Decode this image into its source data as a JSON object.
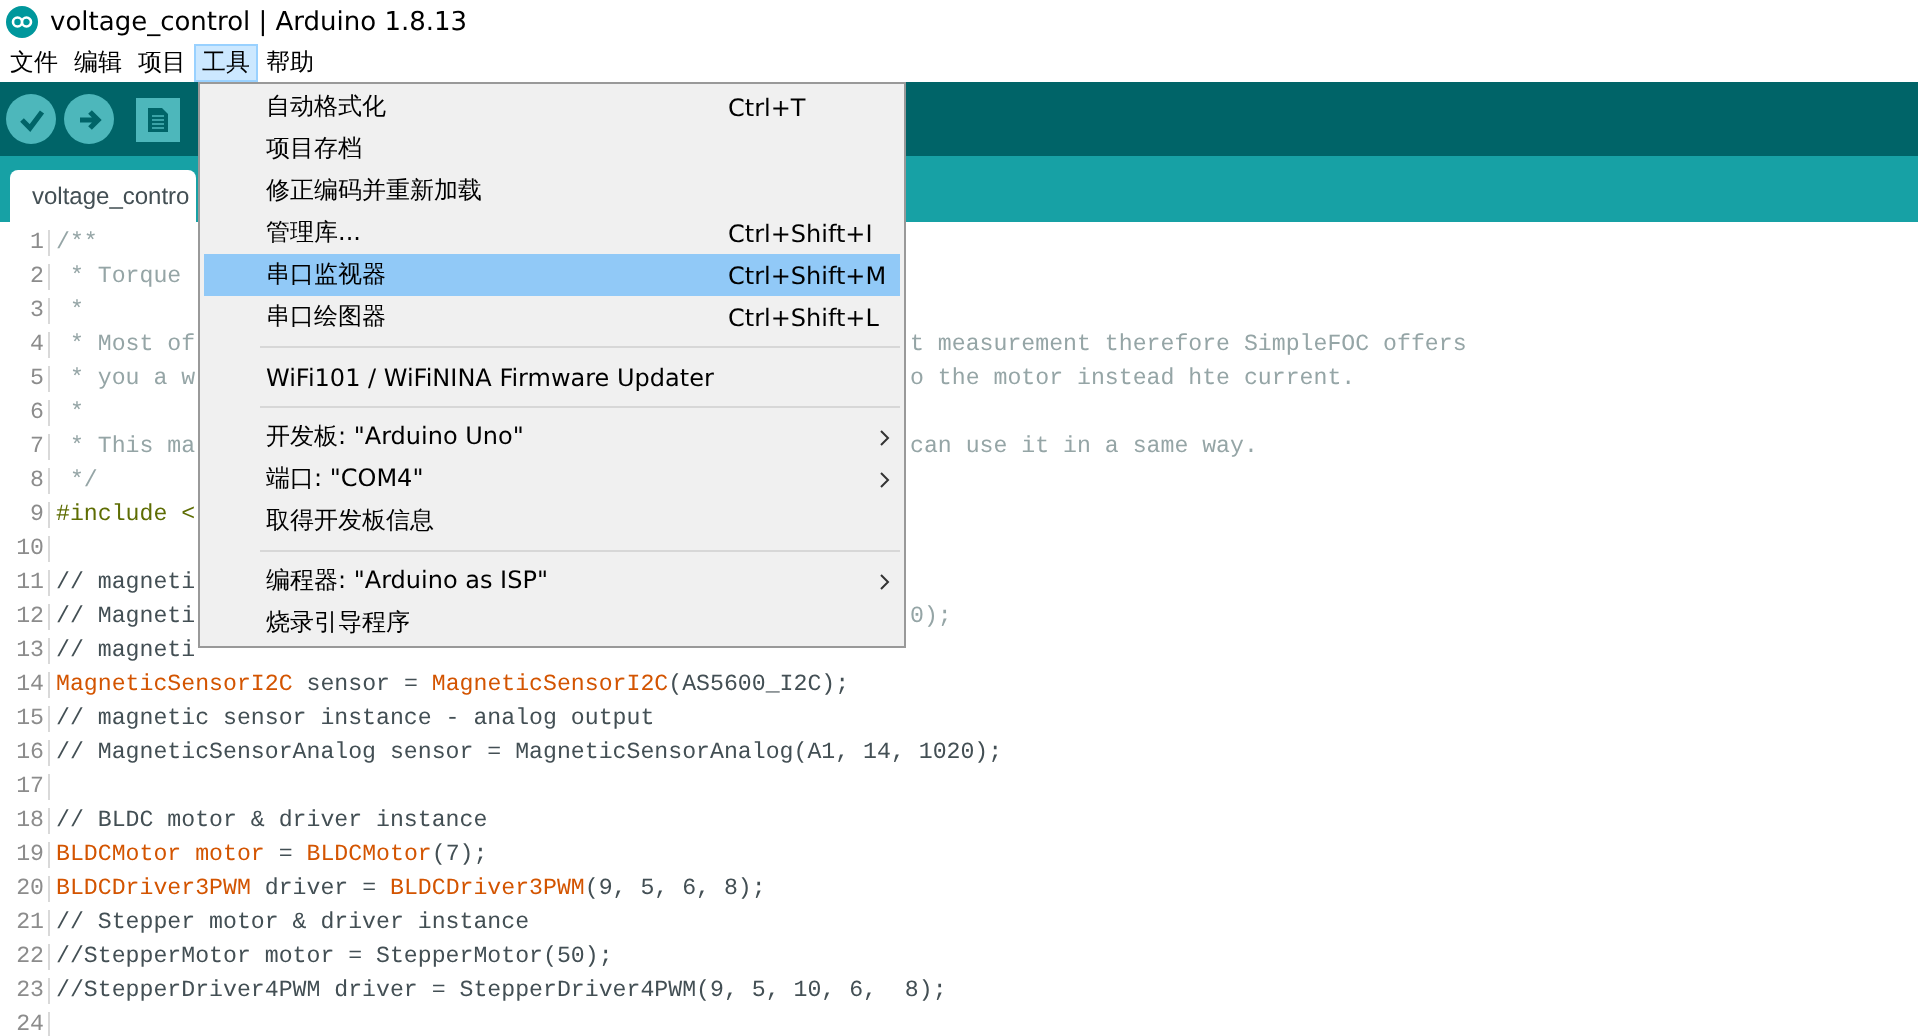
{
  "window": {
    "title": "voltage_control | Arduino 1.8.13"
  },
  "menu_bar": [
    {
      "label": "文件",
      "selected": false
    },
    {
      "label": "编辑",
      "selected": false
    },
    {
      "label": "项目",
      "selected": false
    },
    {
      "label": "工具",
      "selected": true
    },
    {
      "label": "帮助",
      "selected": false
    }
  ],
  "tabs": [
    {
      "label": "voltage_contro",
      "selected": true
    }
  ],
  "code_lines": [
    {
      "number": "1",
      "segments": [
        {
          "text": "/**",
          "kind": "comment"
        }
      ]
    },
    {
      "number": "2",
      "segments": [
        {
          "text": " * Torque",
          "kind": "comment"
        }
      ]
    },
    {
      "number": "3",
      "segments": [
        {
          "text": " *",
          "kind": "comment"
        }
      ]
    },
    {
      "number": "4",
      "segments": [
        {
          "text": " * Most of",
          "kind": "comment"
        }
      ],
      "tail": "t measurement therefore SimpleFOC offers"
    },
    {
      "number": "5",
      "segments": [
        {
          "text": " * you a w",
          "kind": "comment"
        }
      ],
      "tail": "o the motor instead hte current."
    },
    {
      "number": "6",
      "segments": [
        {
          "text": " *",
          "kind": "comment"
        }
      ]
    },
    {
      "number": "7",
      "segments": [
        {
          "text": " * This ma",
          "kind": "comment"
        }
      ],
      "tail": "can use it in a same way."
    },
    {
      "number": "8",
      "segments": [
        {
          "text": " */",
          "kind": "comment"
        }
      ]
    },
    {
      "number": "9",
      "segments": [
        {
          "text": "#include <",
          "kind": "directive"
        }
      ]
    },
    {
      "number": "10"
    },
    {
      "number": "11",
      "segments": [
        {
          "text": "// magneti",
          "kind": "plain"
        }
      ]
    },
    {
      "number": "12",
      "segments": [
        {
          "text": "// Magneti",
          "kind": "plain"
        }
      ],
      "tail": "0);"
    },
    {
      "number": "13",
      "segments": [
        {
          "text": "// magneti",
          "kind": "plain"
        }
      ]
    },
    {
      "number": "14",
      "segments": [
        {
          "text": "MagneticSensorI2C",
          "kind": "type"
        },
        {
          "text": " sensor = ",
          "kind": "plain"
        },
        {
          "text": "MagneticSensorI2C",
          "kind": "type"
        },
        {
          "text": "(AS5600_I2C);",
          "kind": "plain"
        }
      ]
    },
    {
      "number": "15",
      "segments": [
        {
          "text": "// magnetic sensor instance - analog output",
          "kind": "plain"
        }
      ]
    },
    {
      "number": "16",
      "segments": [
        {
          "text": "// MagneticSensorAnalog sensor = MagneticSensorAnalog(A1, 14, 1020);",
          "kind": "plain"
        }
      ]
    },
    {
      "number": "17"
    },
    {
      "number": "18",
      "segments": [
        {
          "text": "// BLDC motor & driver instance",
          "kind": "plain"
        }
      ]
    },
    {
      "number": "19",
      "segments": [
        {
          "text": "BLDCMotor motor",
          "kind": "type"
        },
        {
          "text": " = ",
          "kind": "plain"
        },
        {
          "text": "BLDCMotor",
          "kind": "type"
        },
        {
          "text": "(7);",
          "kind": "plain"
        }
      ]
    },
    {
      "number": "20",
      "segments": [
        {
          "text": "BLDCDriver3PWM",
          "kind": "type"
        },
        {
          "text": " driver = ",
          "kind": "plain"
        },
        {
          "text": "BLDCDriver3PWM",
          "kind": "type"
        },
        {
          "text": "(9, 5, 6, 8);",
          "kind": "plain"
        }
      ]
    },
    {
      "number": "21",
      "segments": [
        {
          "text": "// Stepper motor & driver instance",
          "kind": "plain"
        }
      ]
    },
    {
      "number": "22",
      "segments": [
        {
          "text": "//StepperMotor motor = StepperMotor(50);",
          "kind": "plain"
        }
      ]
    },
    {
      "number": "23",
      "segments": [
        {
          "text": "//StepperDriver4PWM driver = StepperDriver4PWM(9, 5, 10, 6,  8);",
          "kind": "plain"
        }
      ]
    },
    {
      "number": "24"
    }
  ],
  "tools_menu": [
    {
      "kind": "item",
      "label": "自动格式化",
      "shortcut": "Ctrl+T",
      "selected": false
    },
    {
      "kind": "item",
      "label": "项目存档",
      "selected": false
    },
    {
      "kind": "item",
      "label": "修正编码并重新加载",
      "selected": false
    },
    {
      "kind": "item",
      "label": "管理库...",
      "shortcut": "Ctrl+Shift+I",
      "selected": false
    },
    {
      "kind": "item",
      "label": "串口监视器",
      "shortcut": "Ctrl+Shift+M",
      "selected": true
    },
    {
      "kind": "item",
      "label": "串口绘图器",
      "shortcut": "Ctrl+Shift+L",
      "selected": false
    },
    {
      "kind": "separator"
    },
    {
      "kind": "item",
      "label": "WiFi101 / WiFiNINA Firmware Updater",
      "selected": false
    },
    {
      "kind": "separator"
    },
    {
      "kind": "item",
      "label": "开发板: \"Arduino Uno\"",
      "selected": false,
      "submenu": true
    },
    {
      "kind": "item",
      "label": "端口: \"COM4\"",
      "selected": false,
      "submenu": true
    },
    {
      "kind": "item",
      "label": "取得开发板信息",
      "selected": false
    },
    {
      "kind": "separator"
    },
    {
      "kind": "item",
      "label": "编程器: \"Arduino as ISP\"",
      "selected": false,
      "submenu": true
    },
    {
      "kind": "item",
      "label": "烧录引导程序",
      "selected": false
    }
  ]
}
